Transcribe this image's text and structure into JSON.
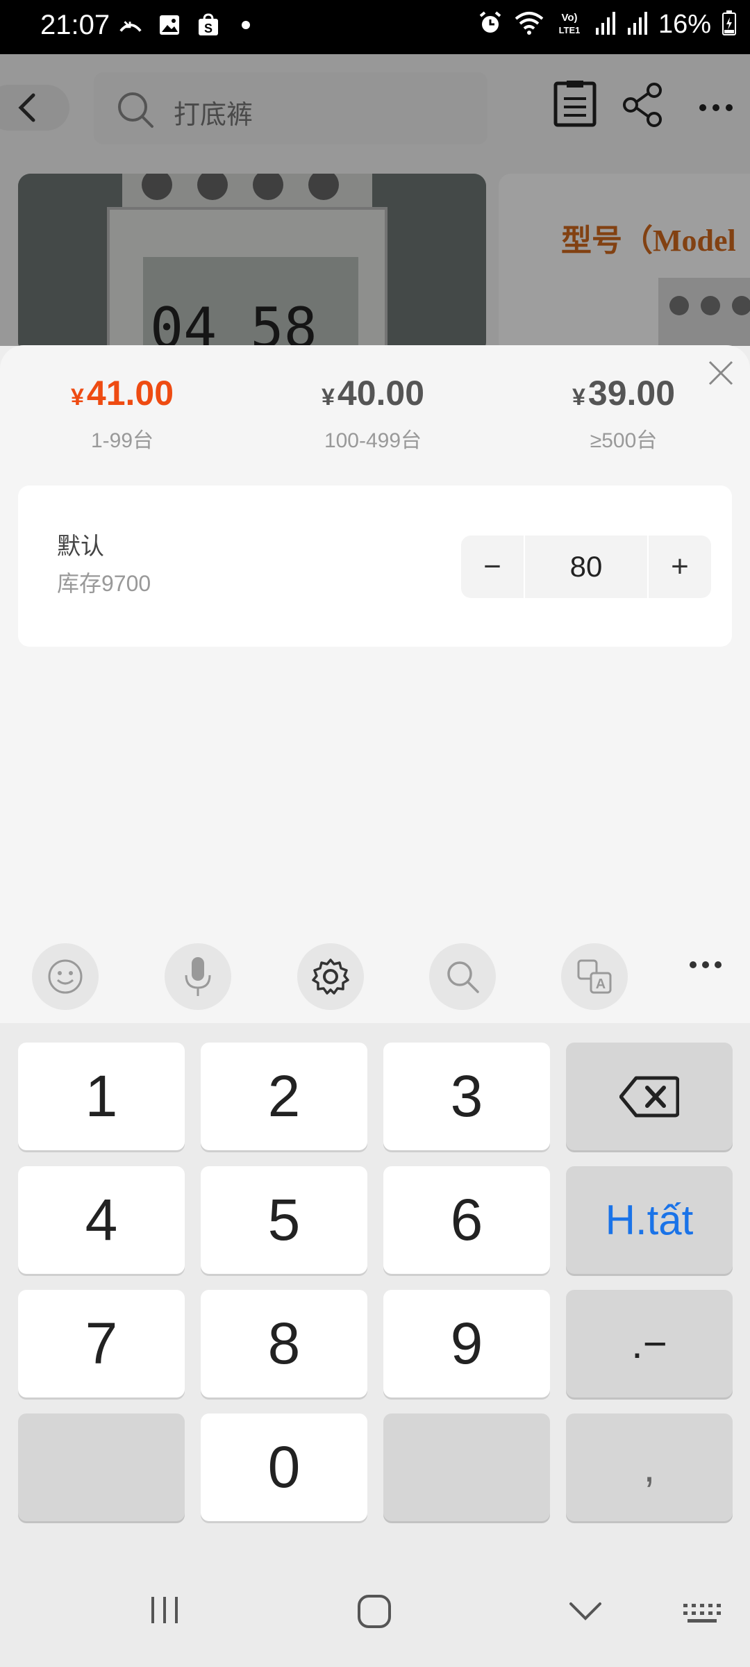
{
  "status_bar": {
    "time": "21:07",
    "battery": "16%",
    "left_icons": [
      "missed-call-icon",
      "gallery-icon",
      "shopee-icon",
      "dot-icon"
    ],
    "right_icons": [
      "alarm-icon",
      "wifi-icon",
      "volte-lte-icon",
      "signal-icon",
      "signal-icon",
      "battery-icon"
    ]
  },
  "topbar": {
    "search_placeholder": "打底裤",
    "icons": [
      "back-icon",
      "search-icon",
      "clipboard-icon",
      "share-icon",
      "more-icon"
    ]
  },
  "background": {
    "model_text": "型号（Model"
  },
  "price_tiers": [
    {
      "currency": "¥",
      "price": "41.00",
      "range": "1-99台",
      "active": true
    },
    {
      "currency": "¥",
      "price": "40.00",
      "range": "100-499台",
      "active": false
    },
    {
      "currency": "¥",
      "price": "39.00",
      "range": "≥500台",
      "active": false
    }
  ],
  "sku": {
    "name": "默认",
    "stock": "库存9700",
    "quantity": "80",
    "minus": "−",
    "plus": "+"
  },
  "keyboard": {
    "toolbar_icons": [
      "emoji-icon",
      "microphone-icon",
      "settings-icon",
      "search-icon",
      "translate-icon",
      "more-icon"
    ],
    "keys": {
      "k1": "1",
      "k2": "2",
      "k3": "3",
      "k4": "4",
      "k5": "5",
      "k6": "6",
      "done": "H.tất",
      "k7": "7",
      "k8": "8",
      "k9": "9",
      "dot_dash": ".−",
      "k0": "0",
      "comma": ","
    }
  },
  "nav_icons": [
    "recents-icon",
    "home-icon",
    "back-chevron-icon",
    "keyboard-icon"
  ],
  "colors": {
    "accent_price": "#ee4b12",
    "done_key": "#1a73e8"
  }
}
